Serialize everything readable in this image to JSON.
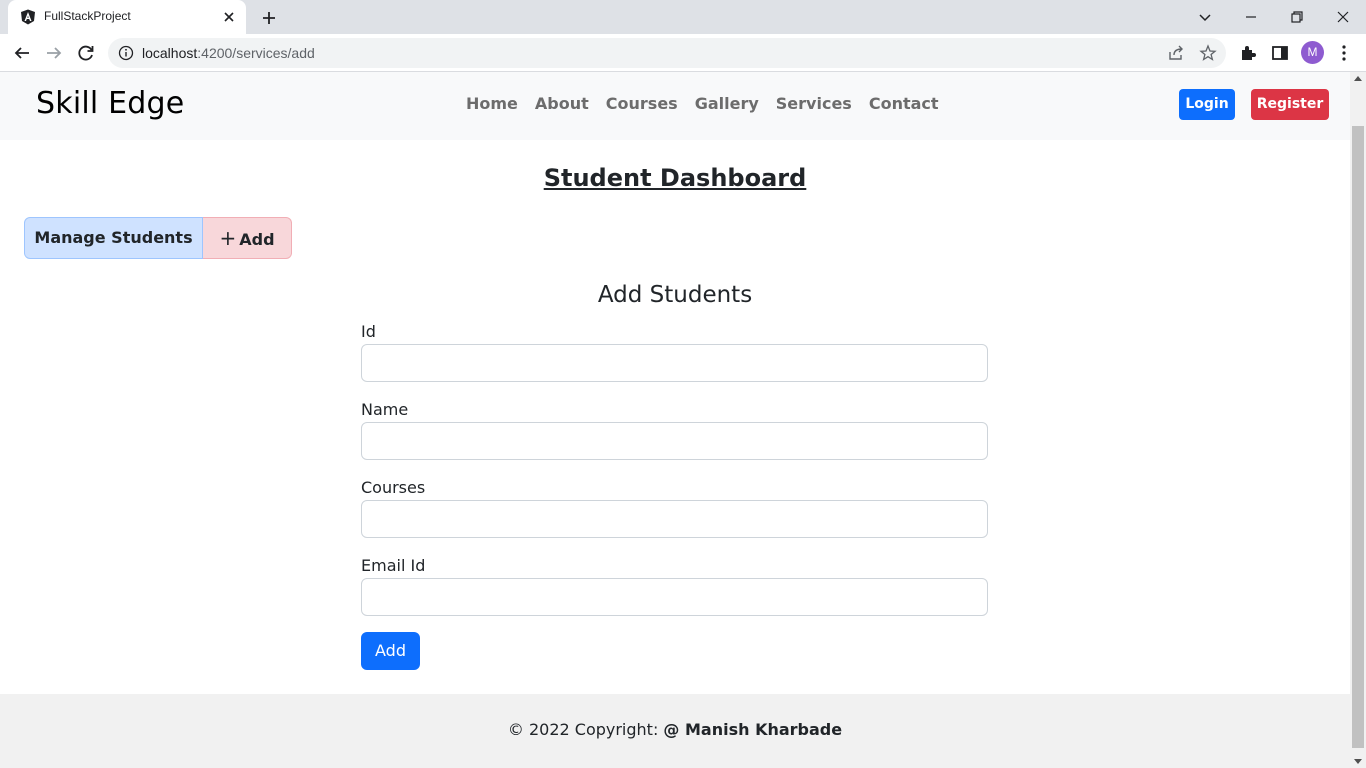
{
  "browser": {
    "tab_title": "FullStackProject",
    "url_host": "localhost",
    "url_rest": ":4200/services/add",
    "profile_initial": "M"
  },
  "navbar": {
    "brand": "Skill Edge",
    "links": [
      "Home",
      "About",
      "Courses",
      "Gallery",
      "Services",
      "Contact"
    ],
    "login_label": "Login",
    "register_label": "Register"
  },
  "dashboard": {
    "title": "Student Dashboard",
    "manage_label": "Manage Students",
    "add_label": "Add"
  },
  "form": {
    "title": "Add Students",
    "fields": [
      {
        "label": "Id",
        "value": ""
      },
      {
        "label": "Name",
        "value": ""
      },
      {
        "label": "Courses",
        "value": ""
      },
      {
        "label": "Email Id",
        "value": ""
      }
    ],
    "submit_label": "Add"
  },
  "footer": {
    "prefix": "© 2022 Copyright: ",
    "author": "@ Manish Kharbade"
  },
  "colors": {
    "primary": "#0d6efd",
    "danger": "#dc3545",
    "manage_bg": "#cfe2ff",
    "add_bg": "#f8d7da"
  }
}
